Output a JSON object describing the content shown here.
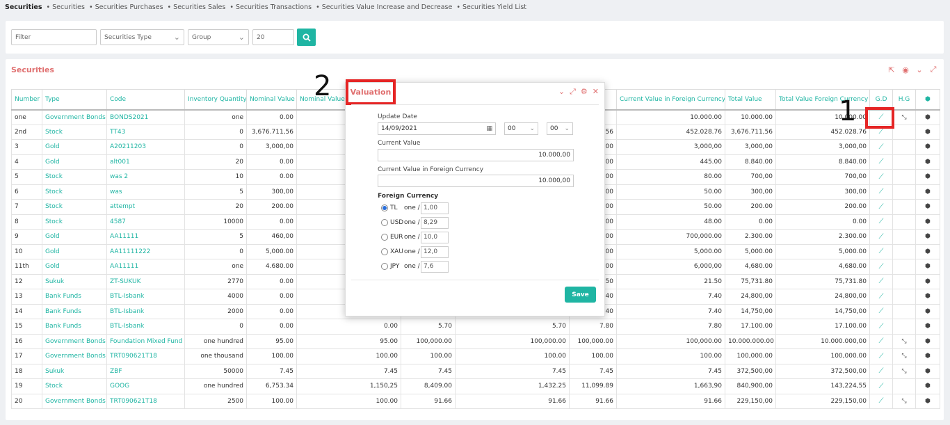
{
  "breadcrumb": {
    "current": "Securities",
    "items": [
      "Securities",
      "Securities Purchases",
      "Securities Sales",
      "Securities Transactions",
      "Securities Value Increase and Decrease",
      "Securities Yield List"
    ]
  },
  "filter": {
    "filter_placeholder": "Filter",
    "type_value": "Securities Type",
    "group_value": "Group",
    "page_size": "20"
  },
  "main": {
    "title": "Securities",
    "columns": [
      "Number",
      "Type",
      "Code",
      "Inventory Quantity",
      "Nominal Value",
      "Nominal Value",
      "",
      "",
      "",
      "Current Value in Foreign Currency",
      "Total Value",
      "Total Value Foreign Currency",
      "G.D",
      "H.G",
      ""
    ],
    "rows": [
      [
        "one",
        "Government Bonds",
        "BONDS2021",
        "one",
        "0.00",
        "",
        "",
        "",
        "",
        "10.000.00",
        "10.000.00",
        "10.000.00",
        true,
        true
      ],
      [
        "2nd",
        "Stock",
        "TT43",
        "0",
        "3,676.711,56",
        "",
        "",
        "",
        "56",
        "452.028.76",
        "3,676.711,56",
        "452.028.76",
        true,
        false
      ],
      [
        "3",
        "Gold",
        "A20211203",
        "0",
        "3,000,00",
        "",
        "",
        "",
        "00",
        "3,000,00",
        "3,000,00",
        "3,000,00",
        true,
        false
      ],
      [
        "4",
        "Gold",
        "alt001",
        "20",
        "0.00",
        "",
        "",
        "",
        "00",
        "445.00",
        "8.840.00",
        "8.840.00",
        true,
        false
      ],
      [
        "5",
        "Stock",
        "was 2",
        "10",
        "0.00",
        "",
        "",
        "",
        "00",
        "80.00",
        "700,00",
        "700,00",
        true,
        false
      ],
      [
        "6",
        "Stock",
        "was",
        "5",
        "300,00",
        "",
        "",
        "",
        "00",
        "50.00",
        "300,00",
        "300,00",
        true,
        false
      ],
      [
        "7",
        "Stock",
        "attempt",
        "20",
        "200.00",
        "",
        "",
        "",
        "00",
        "50.00",
        "200.00",
        "200.00",
        true,
        false
      ],
      [
        "8",
        "Stock",
        "4587",
        "10000",
        "0.00",
        "",
        "",
        "",
        "00",
        "48.00",
        "0.00",
        "0.00",
        true,
        false
      ],
      [
        "9",
        "Gold",
        "AA11111",
        "5",
        "460,00",
        "",
        "",
        "",
        "00",
        "700,000.00",
        "2.300.00",
        "2.300.00",
        true,
        false
      ],
      [
        "10",
        "Gold",
        "AA11111222",
        "0",
        "5,000.00",
        "",
        "",
        "",
        "00",
        "5,000.00",
        "5,000.00",
        "5,000.00",
        true,
        false
      ],
      [
        "11th",
        "Gold",
        "AA11111",
        "one",
        "4.680.00",
        "",
        "",
        "",
        "00",
        "6,000,00",
        "4,680.00",
        "4,680.00",
        true,
        false
      ],
      [
        "12",
        "Sukuk",
        "ZT-SUKUK",
        "2770",
        "0.00",
        "",
        "",
        "",
        "50",
        "21.50",
        "75,731.80",
        "75,731.80",
        true,
        false
      ],
      [
        "13",
        "Bank Funds",
        "BTL-Isbank",
        "4000",
        "0.00",
        "",
        "",
        "",
        "40",
        "7.40",
        "24,800,00",
        "24,800,00",
        true,
        false
      ],
      [
        "14",
        "Bank Funds",
        "BTL-Isbank",
        "2000",
        "0.00",
        "",
        "",
        "",
        "40",
        "7.40",
        "14,750,00",
        "14,750,00",
        true,
        false
      ],
      [
        "15",
        "Bank Funds",
        "BTL-Isbank",
        "0",
        "0.00",
        "0.00",
        "5.70",
        "5.70",
        "7.80",
        "7.80",
        "17.100.00",
        "17.100.00",
        true,
        false
      ],
      [
        "16",
        "Government Bonds",
        "Foundation Mixed Fund",
        "one hundred",
        "95.00",
        "95.00",
        "100,000.00",
        "100,000.00",
        "100,000.00",
        "100,000.00",
        "10.000.000.00",
        "10.000.000,00",
        true,
        true
      ],
      [
        "17",
        "Government Bonds",
        "TRT090621T18",
        "one thousand",
        "100.00",
        "100.00",
        "100.00",
        "100.00",
        "100.00",
        "100.00",
        "100,000.00",
        "100,000.00",
        true,
        true
      ],
      [
        "18",
        "Sukuk",
        "ZBF",
        "50000",
        "7.45",
        "7.45",
        "7.45",
        "7.45",
        "7.45",
        "7.45",
        "372,500,00",
        "372,500,00",
        true,
        true
      ],
      [
        "19",
        "Stock",
        "GOOG",
        "one hundred",
        "6,753.34",
        "1,150,25",
        "8,409.00",
        "1,432.25",
        "11,099.89",
        "1,663,90",
        "840,900,00",
        "143,224,55",
        true,
        false
      ],
      [
        "20",
        "Government Bonds",
        "TRT090621T18",
        "2500",
        "100.00",
        "100.00",
        "91.66",
        "91.66",
        "91.66",
        "91.66",
        "229,150,00",
        "229,150,00",
        true,
        true
      ]
    ]
  },
  "annotations": {
    "one": "1",
    "two": "2"
  },
  "modal": {
    "title": "Valuation",
    "update_date_label": "Update Date",
    "update_date": "14/09/2021",
    "hour": "00",
    "minute": "00",
    "current_value_label": "Current Value",
    "current_value": "10.000,00",
    "current_value_fc_label": "Current Value in Foreign Currency",
    "current_value_fc": "10.000,00",
    "foreign_currency_label": "Foreign Currency",
    "currencies": [
      {
        "code": "TL",
        "one": "one /",
        "rate": "1,00"
      },
      {
        "code": "USD",
        "one": "one /",
        "rate": "8,29"
      },
      {
        "code": "EUR",
        "one": "one /",
        "rate": "10,0"
      },
      {
        "code": "XAU",
        "one": "one /",
        "rate": "12,0"
      },
      {
        "code": "JPY",
        "one": "one /",
        "rate": "7,6"
      }
    ],
    "selected_currency": "TL",
    "save_label": "Save"
  },
  "colors": {
    "accent": "#1fb5a3",
    "title": "#e07070",
    "highlight": "#e52525"
  }
}
